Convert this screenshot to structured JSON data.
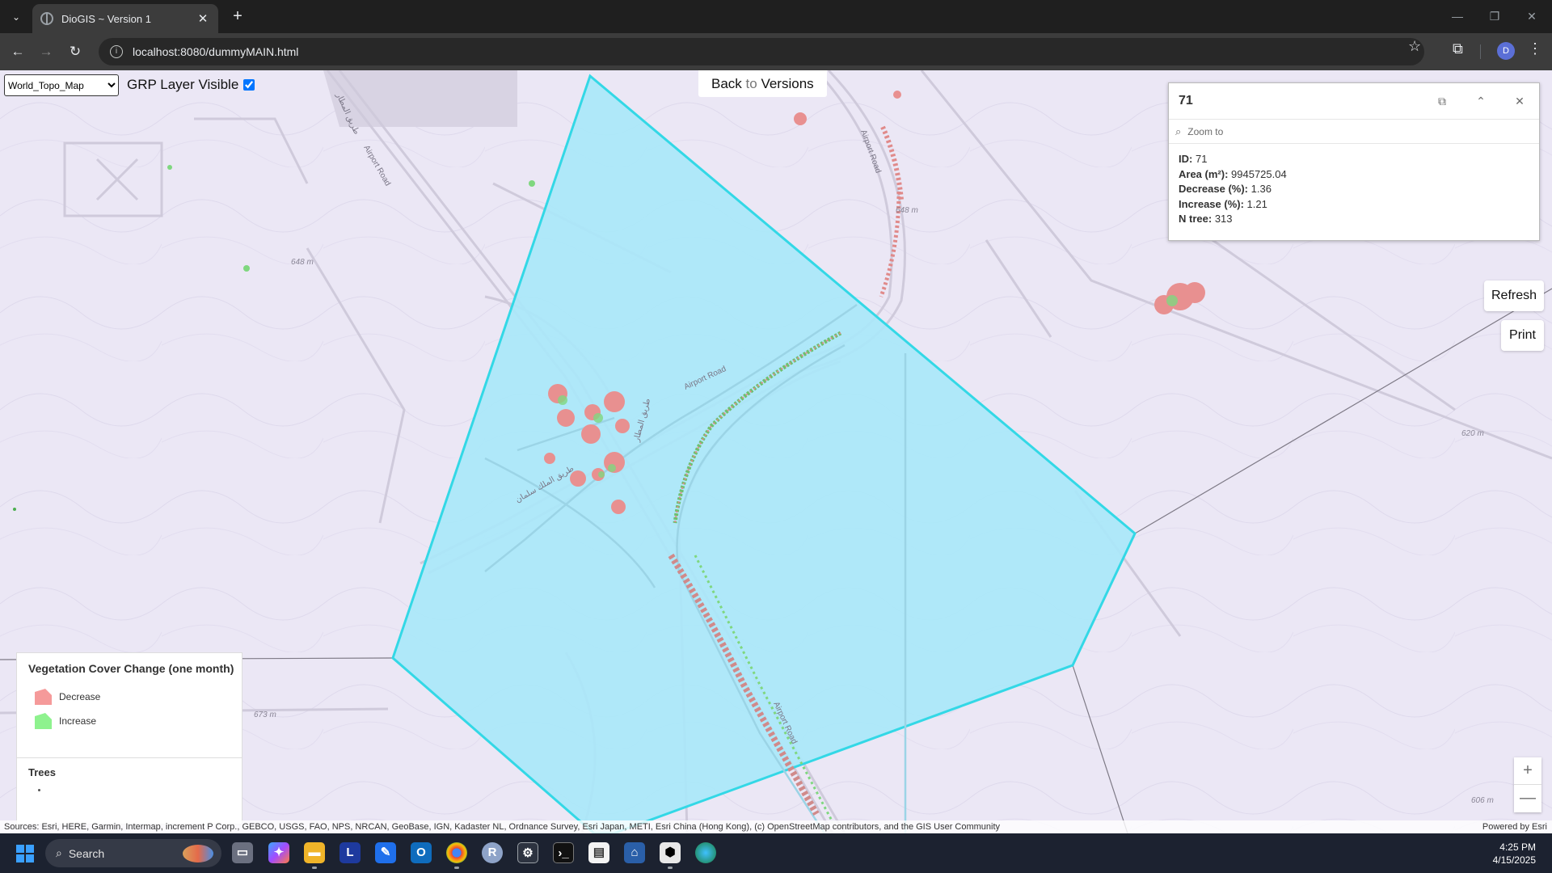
{
  "browser": {
    "tab_title": "DioGIS ~ Version 1",
    "url": "localhost:8080/dummyMAIN.html"
  },
  "toolbar": {
    "basemap_selected": "World_Topo_Map",
    "grp_label": "GRP Layer Visible",
    "grp_checked": true,
    "back_label_1": "Back",
    "back_label_2": "to",
    "back_label_3": "Versions"
  },
  "popup": {
    "title": "71",
    "zoom_label": "Zoom to",
    "fields": [
      {
        "label": "ID:",
        "value": "71"
      },
      {
        "label": "Area (m²):",
        "value": "9945725.04"
      },
      {
        "label": "Decrease (%):",
        "value": "1.36"
      },
      {
        "label": "Increase (%):",
        "value": "1.21"
      },
      {
        "label": "N tree:",
        "value": "313"
      }
    ]
  },
  "buttons": {
    "refresh": "Refresh",
    "print": "Print"
  },
  "legend": {
    "title": "Vegetation Cover Change (one month)",
    "decrease_label": "Decrease",
    "decrease_color": "#f59a9a",
    "increase_label": "Increase",
    "increase_color": "#8ef28e",
    "trees_title": "Trees"
  },
  "map": {
    "polygon_fill": "#a9e8f9",
    "polygon_stroke": "#33d8e6",
    "labels": {
      "airport_road_1": "Airport Road",
      "airport_road_2": "Airport Road",
      "airport_road_3": "Airport Road",
      "airport_road_4": "Airport Road",
      "arabic_1": "طريق المطار",
      "arabic_2": "طريق المطار",
      "arabic_3": "طريق الملك سلمان",
      "elev_648a": "648 m",
      "elev_648b": "648 m",
      "elev_620": "620 m",
      "elev_673": "673 m",
      "elev_606": "606 m"
    }
  },
  "attribution": {
    "sources": "Sources: Esri, HERE, Garmin, Intermap, increment P Corp., GEBCO, USGS, FAO, NPS, NRCAN, GeoBase, IGN, Kadaster NL, Ordnance Survey, Esri Japan, METI, Esri China (Hong Kong), (c) OpenStreetMap contributors, and the GIS User Community",
    "powered": "Powered by Esri"
  },
  "taskbar": {
    "search": "Search",
    "time": "4:25 PM",
    "date": "4/15/2025"
  }
}
